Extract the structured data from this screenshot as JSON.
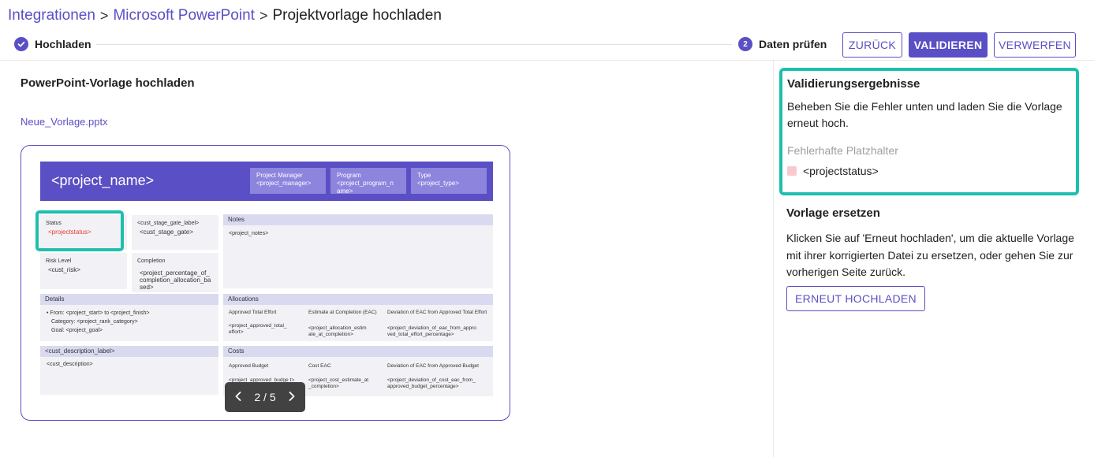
{
  "breadcrumb": {
    "items": [
      "Integrationen",
      "Microsoft PowerPoint"
    ],
    "current": "Projektvorlage hochladen",
    "separator": ">"
  },
  "stepper": {
    "step1": {
      "label": "Hochladen",
      "status": "completed"
    },
    "step2": {
      "number": "2",
      "label": "Daten prüfen",
      "status": "active"
    }
  },
  "actions": {
    "back": "ZURÜCK",
    "validate": "VALIDIEREN",
    "discard": "VERWERFEN"
  },
  "left": {
    "title": "PowerPoint-Vorlage hochladen",
    "file_name": "Neue_Vorlage.pptx"
  },
  "slide": {
    "project_name": "<project_name>",
    "boxes": [
      {
        "label": "Project Manager",
        "value": "<project_manager>"
      },
      {
        "label": "Program",
        "value": "<project_program_n ame>"
      },
      {
        "label": "Type",
        "value": "<project_type>"
      }
    ],
    "status": {
      "label": "Status",
      "value": "<projectstatus>"
    },
    "stage_gate": {
      "label": "<cust_stage_gate_label>",
      "value": "<cust_stage_gate>"
    },
    "risk": {
      "label": "Risk Level",
      "value": "<cust_risk>"
    },
    "completion": {
      "label": "Completion",
      "value": "<project_percentage_of_ completion_allocation_ba sed>"
    },
    "notes": {
      "label": "Notes",
      "value": "<project_notes>"
    },
    "details": {
      "label": "Details",
      "from": "From:  <project_start>  to  <project_finish>",
      "category": "Category:  <project_rank_category>",
      "goal": "Goal:  <project_goal>"
    },
    "allocations": {
      "label": "Allocations",
      "cols": [
        {
          "head": "Approved Total Effort",
          "value": "<project_approved_total_ effort>"
        },
        {
          "head": "Estimate at Completion (EAC)",
          "value": "<project_allocation_estim ate_at_completion>"
        },
        {
          "head": "Deviation of EAC from Approved Total Effort",
          "value": "<project_deviation_of_eac_from_appro ved_total_effort_percentage>"
        }
      ]
    },
    "description": {
      "label": "<cust_description_label>",
      "value": "<cust_description>"
    },
    "costs": {
      "label": "Costs",
      "cols": [
        {
          "head": "Approved Budget",
          "value": "<project_approved_budge t>"
        },
        {
          "head": "Cost EAC",
          "value": "<project_cost_estimate_at _completion>"
        },
        {
          "head": "Deviation of EAC from Approved Budget",
          "value": "<project_deviation_of_cost_eac_from_ approved_budget_percentage>"
        }
      ]
    }
  },
  "pager": {
    "text": "2 / 5",
    "current": 2,
    "total": 5
  },
  "results": {
    "title": "Validierungsergebnisse",
    "text": "Beheben Sie die Fehler unten und laden Sie die Vorlage erneut hoch.",
    "subtitle": "Fehlerhafte Platzhalter",
    "items": [
      "<projectstatus>"
    ]
  },
  "replace": {
    "title": "Vorlage ersetzen",
    "text": "Klicken Sie auf 'Erneut hochladen', um die aktuelle Vorlage mit ihrer korrigierten Datei zu ersetzen, oder gehen Sie zur vorherigen Seite zurück.",
    "button": "ERNEUT HOCHLADEN"
  },
  "colors": {
    "accent": "#5a4fc4",
    "highlight": "#1fbfad",
    "error_chip": "#f8c9cf",
    "error_text": "#e53935"
  }
}
